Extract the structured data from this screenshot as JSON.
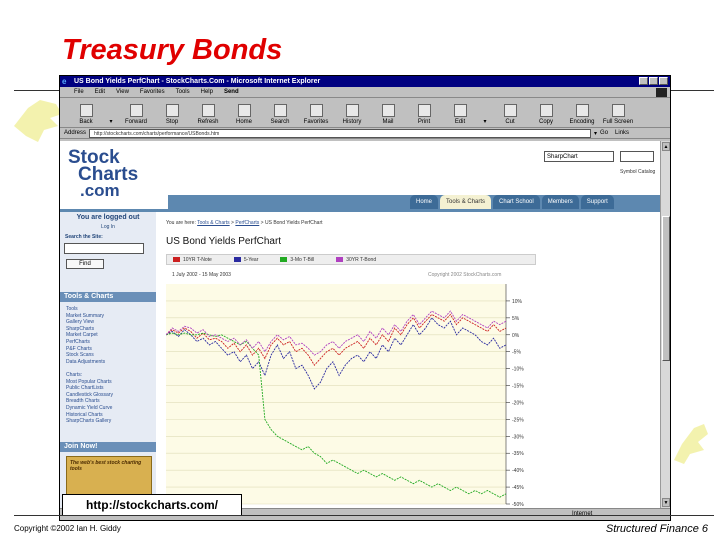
{
  "slide": {
    "title": "Treasury Bonds",
    "url_caption": "http://stockcharts.com/",
    "footer_left": "Copyright ©2002 Ian H. Giddy",
    "footer_right": "Structured Finance 6"
  },
  "browser": {
    "window_title": "US Bond Yields PerfChart - StockCharts.Com - Microsoft Internet Explorer",
    "menu": [
      "File",
      "Edit",
      "View",
      "Favorites",
      "Tools",
      "Help"
    ],
    "menu_send": "Send",
    "toolbar": [
      "Back",
      "Forward",
      "Stop",
      "Refresh",
      "Home",
      "Search",
      "Favorites",
      "History",
      "Mail",
      "Print",
      "Edit",
      "Cut",
      "Copy",
      "Encoding",
      "Full Screen"
    ],
    "address_label": "Address",
    "address_value": "http://stockcharts.com/charts/performance/USBonds.htm",
    "go_label": "Go",
    "links_label": "Links",
    "status_zone": "Internet"
  },
  "site": {
    "logo": [
      "Stock",
      "Charts",
      ".com"
    ],
    "chart_select": "SharpChart",
    "go_label": "Go!",
    "symbol_catalog": "Symbol Catalog",
    "nav_tabs": [
      "Home",
      "Tools & Charts",
      "Chart School",
      "Members",
      "Support"
    ],
    "sidebar": {
      "logged_in": "You are logged out",
      "login_link": "Log In",
      "search_label": "Search the Site:",
      "find_button": "Find",
      "tools_header": "Tools & Charts",
      "tools_items": [
        "Tools",
        "Market Summary",
        "Gallery View",
        "SharpCharts",
        "Market Carpet",
        "PerfCharts",
        "P&F Charts",
        "Stock Scans",
        "Data Adjustments"
      ],
      "charts_header": "Charts:",
      "charts_items": [
        "Most Popular Charts",
        "Public ChartLists",
        "Candlestick Glossary",
        "Breadth Charts",
        "Dynamic Yield Curve",
        "Historical Charts",
        "SharpCharts Gallery"
      ],
      "join_header": "Join Now!",
      "ad_text": "The web's best stock charting tools"
    },
    "breadcrumb": {
      "prefix": "You are here:",
      "tools": "Tools & Charts",
      "perf": "PerfCharts",
      "current": "US Bond Yields PerfChart"
    },
    "page_heading": "US Bond Yields PerfChart"
  },
  "chart_data": {
    "type": "line",
    "date_range": "1 July 2002 - 15 May 2003",
    "copyright": "Copyright 2002 StockCharts.com",
    "x": [
      0,
      6,
      12,
      18,
      24,
      30,
      36,
      42,
      48,
      54,
      60,
      66,
      72,
      78,
      84,
      90,
      96,
      102,
      108,
      114,
      120,
      126,
      132,
      138,
      144,
      150,
      156,
      162,
      168,
      174,
      180,
      186,
      192,
      198,
      204,
      210,
      216,
      222,
      228,
      234,
      240,
      246,
      252,
      258,
      264,
      270,
      276,
      282,
      288,
      294,
      300,
      306,
      312,
      318,
      324,
      330
    ],
    "ylim": [
      -50,
      15
    ],
    "yticks": [
      "10%",
      "5%",
      "0%",
      "-5%",
      "-10%",
      "-15%",
      "-20%",
      "-25%",
      "-30%",
      "-35%",
      "-40%",
      "-45%",
      "-50%"
    ],
    "series": [
      {
        "name": "10YR T-Note",
        "color": "#cc2020",
        "values": [
          0,
          1.5,
          0.5,
          2,
          1,
          -1,
          0.5,
          -1.5,
          -1,
          -2,
          -4,
          -2.5,
          -5,
          -3,
          -6,
          -4,
          -7,
          -3,
          -1,
          -3,
          -2,
          -5,
          -4,
          -6,
          -9,
          -7,
          -5,
          -4,
          -6,
          -4,
          -3,
          -2,
          -4,
          -1,
          -3,
          0,
          -2,
          2,
          0,
          3,
          5,
          2,
          4,
          6,
          5,
          4,
          6,
          3,
          5,
          4,
          3,
          2,
          1,
          3,
          1,
          2
        ]
      },
      {
        "name": "5-Year",
        "color": "#2a2aa0",
        "values": [
          0,
          1,
          -0.5,
          1.5,
          0,
          -2,
          -1,
          -3,
          -2,
          -4,
          -6,
          -5,
          -8,
          -6,
          -10,
          -8,
          -12,
          -6,
          -3,
          -7,
          -5,
          -10,
          -9,
          -12,
          -16,
          -14,
          -10,
          -8,
          -12,
          -9,
          -7,
          -6,
          -8,
          -5,
          -7,
          -3,
          -5,
          -1,
          -3,
          0,
          3,
          0,
          2,
          5,
          3,
          2,
          4,
          0,
          2,
          1,
          0,
          -2,
          -3,
          -1,
          -4,
          -3
        ]
      },
      {
        "name": "3-Mo T-Bill",
        "color": "#22aa22",
        "values": [
          0,
          0.5,
          0,
          0.5,
          0,
          0,
          0.5,
          0,
          -0.5,
          0,
          -1,
          -2,
          -3,
          -2,
          -4,
          -6,
          -25,
          -28,
          -30,
          -31,
          -32,
          -33,
          -34,
          -33,
          -35,
          -36,
          -38,
          -37,
          -38,
          -39,
          -40,
          -41,
          -40,
          -41,
          -42,
          -41,
          -42,
          -43,
          -42,
          -43,
          -44,
          -43,
          -44,
          -45,
          -44,
          -45,
          -46,
          -45,
          -46,
          -47,
          -46,
          -47,
          -46,
          -47,
          -48,
          -47
        ]
      },
      {
        "name": "30YR T-Bond",
        "color": "#b040c0",
        "values": [
          0,
          2,
          1,
          2.5,
          2,
          0.5,
          1.5,
          -0.5,
          0,
          -1,
          -2,
          -1,
          -3,
          -1.5,
          -4,
          -2,
          -5,
          -2,
          0,
          -1.5,
          -0.5,
          -3,
          -2.5,
          -4,
          -6,
          -5,
          -3,
          -2,
          -4,
          -2,
          -1,
          0,
          -2,
          1,
          -1,
          2,
          0,
          3,
          1,
          4,
          6,
          3,
          5,
          7,
          6,
          5,
          7,
          4,
          6,
          5,
          4,
          3,
          2,
          4,
          3,
          4
        ]
      }
    ]
  }
}
